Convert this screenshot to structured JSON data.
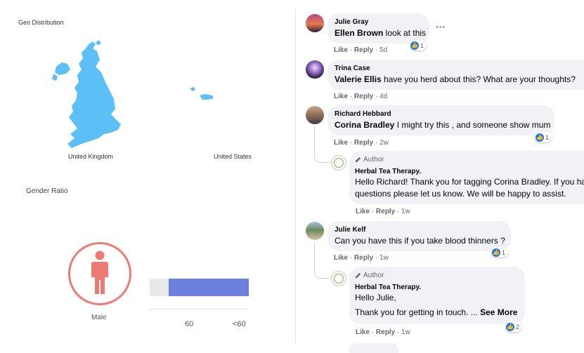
{
  "analytics": {
    "geo_title": "Geo Distribution",
    "countries": [
      {
        "label": "United Kingdom"
      },
      {
        "label": "United States"
      }
    ],
    "gender_title": "Gender Ratio",
    "gender_label": "Male",
    "accent_color": "#ec7b73",
    "bar_color": "#6b7fdc",
    "axis_ticks": [
      "60",
      "<60"
    ]
  },
  "comments": [
    {
      "author": "Julie Gray",
      "mention": "Ellen Brown",
      "text": " look at this",
      "like": "Like",
      "reply": "Reply",
      "time": "5d",
      "reactions": "1"
    },
    {
      "author": "Trina Case",
      "mention": "Valerie Ellis",
      "text": " have you herd about this? What are your thoughts?",
      "like": "Like",
      "reply": "Reply",
      "time": "4d"
    },
    {
      "author": "Richard Hebbard",
      "mention": "Corina Bradley",
      "text": " I might try this , and someone show mum",
      "like": "Like",
      "reply": "Reply",
      "time": "2w",
      "reactions": "1"
    },
    {
      "badge": "Author",
      "author": "Herbal Tea Therapy.",
      "line1": "Hello Richard! Thank you for tagging Corina Bradley. If you have any",
      "line2": "questions please let us know. We will be happy to assist.",
      "like": "Like",
      "reply": "Reply",
      "time": "1w"
    },
    {
      "author": "Julie Kelf",
      "text": "Can you have this if you take blood thinners ?",
      "like": "Like",
      "reply": "Reply",
      "time": "1w",
      "reactions": "1"
    },
    {
      "badge": "Author",
      "author": "Herbal Tea Therapy.",
      "line1": "Hello Julie,",
      "line2": "Thank you for getting in touch. ... ",
      "see_more": "See More",
      "like": "Like",
      "reply": "Reply",
      "time": "1w",
      "reactions": "2"
    }
  ]
}
